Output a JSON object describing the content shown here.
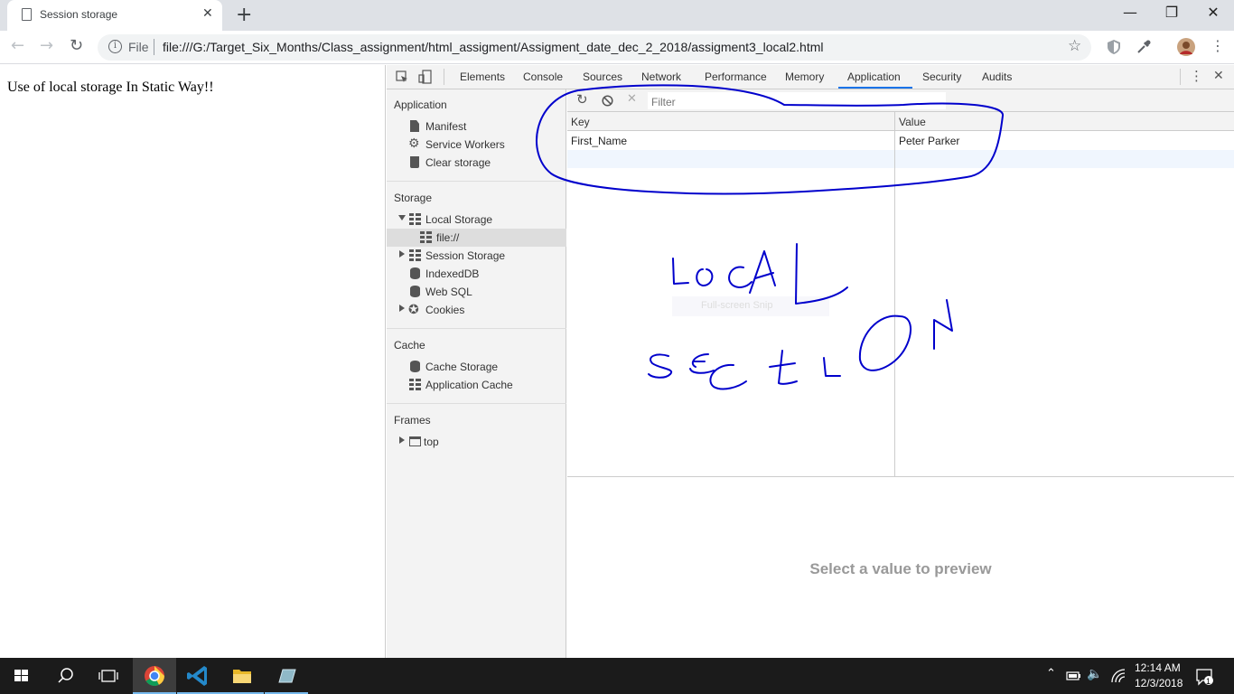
{
  "browser": {
    "tab_title": "Session storage",
    "new_tab_label": "+",
    "window_controls": {
      "minimize": "—",
      "restore": "❐",
      "close": "✕"
    },
    "omnibox": {
      "scheme_label": "File",
      "url": "file:///G:/Target_Six_Months/Class_assignment/html_assigment/Assigment_date_dec_2_2018/assigment3_local2.html"
    }
  },
  "page": {
    "text": "Use of local storage In Static Way!!"
  },
  "devtools": {
    "tabs": [
      "Elements",
      "Console",
      "Sources",
      "Network",
      "Performance",
      "Memory",
      "Application",
      "Security",
      "Audits"
    ],
    "active_tab": "Application",
    "sidebar": {
      "sections": {
        "application": "Application",
        "storage": "Storage",
        "cache": "Cache",
        "frames": "Frames"
      },
      "items": {
        "manifest": "Manifest",
        "service_workers": "Service Workers",
        "clear_storage": "Clear storage",
        "local_storage": "Local Storage",
        "local_file": "file://",
        "session_storage": "Session Storage",
        "indexeddb": "IndexedDB",
        "web_sql": "Web SQL",
        "cookies": "Cookies",
        "cache_storage": "Cache Storage",
        "application_cache": "Application Cache",
        "top": "top"
      }
    },
    "main": {
      "filter_placeholder": "Filter",
      "columns": {
        "key": "Key",
        "value": "Value"
      },
      "rows": [
        {
          "key": "First_Name",
          "value": "Peter Parker"
        }
      ],
      "preview_text": "Select a value to preview",
      "snip_overlay": "Full-screen Snip"
    }
  },
  "taskbar": {
    "time": "12:14 AM",
    "date": "12/3/2018",
    "notification_count": "1"
  },
  "annotation": {
    "handwritten_text": "LOCAL SECTION",
    "color": "#0000cc"
  }
}
